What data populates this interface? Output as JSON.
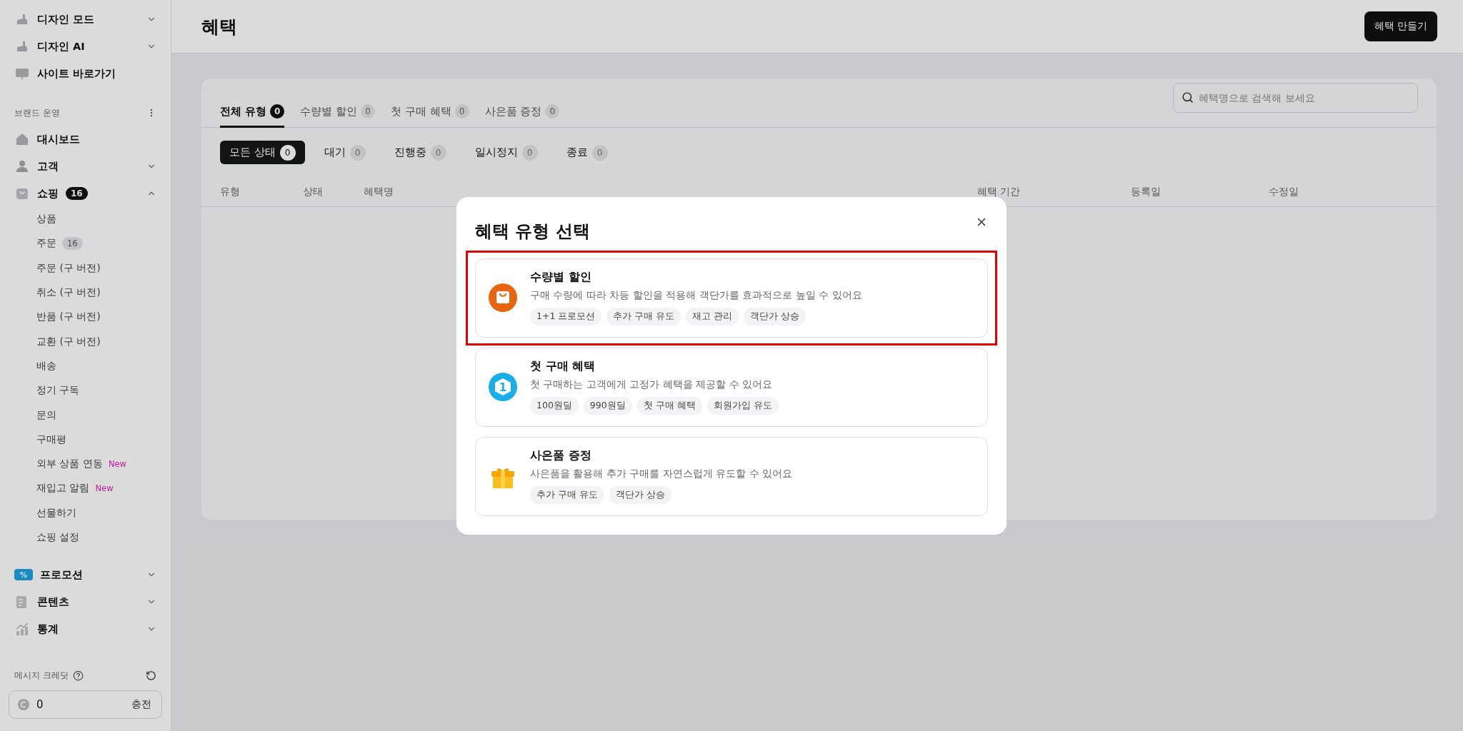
{
  "sidebar": {
    "top_items": [
      {
        "label": "디자인 모드",
        "expandable": true,
        "expanded": false
      },
      {
        "label": "디자인 AI",
        "expandable": true,
        "expanded": false
      },
      {
        "label": "사이트 바로가기",
        "expandable": false
      }
    ],
    "section": {
      "title": "브랜드 운영"
    },
    "items": [
      {
        "label": "대시보드",
        "expandable": false
      },
      {
        "label": "고객",
        "expandable": true,
        "expanded": false
      },
      {
        "label": "쇼핑",
        "badge": "16",
        "expandable": true,
        "expanded": true,
        "children": [
          {
            "label": "상품"
          },
          {
            "label": "주문",
            "badge": "16"
          },
          {
            "label": "주문 (구 버전)"
          },
          {
            "label": "취소 (구 버전)"
          },
          {
            "label": "반품 (구 버전)"
          },
          {
            "label": "교환 (구 버전)"
          },
          {
            "label": "배송"
          },
          {
            "label": "정기 구독"
          },
          {
            "label": "문의"
          },
          {
            "label": "구매평"
          },
          {
            "label": "외부 상품 연동",
            "new_tag": "New"
          },
          {
            "label": "재입고 알림",
            "new_tag": "New"
          },
          {
            "label": "선물하기"
          },
          {
            "label": "쇼핑 설정"
          }
        ]
      },
      {
        "label": "프로모션",
        "icon_label": "%",
        "expandable": true,
        "expanded": false
      },
      {
        "label": "콘텐츠",
        "expandable": true,
        "expanded": false
      },
      {
        "label": "통계",
        "expandable": true,
        "expanded": false
      }
    ],
    "credit": {
      "label": "메시지 크레딧",
      "value": "0",
      "action": "충전"
    }
  },
  "header": {
    "title": "혜택",
    "button": "혜택 만들기"
  },
  "type_tabs": [
    {
      "label": "전체 유형",
      "count": "0",
      "selected": true
    },
    {
      "label": "수량별 할인",
      "count": "0",
      "selected": false
    },
    {
      "label": "첫 구매 혜택",
      "count": "0",
      "selected": false
    },
    {
      "label": "사은품 증정",
      "count": "0",
      "selected": false
    }
  ],
  "search": {
    "placeholder": "혜택명으로 검색해 보세요"
  },
  "status_filters": [
    {
      "label": "모든 상태",
      "count": "0",
      "selected": true
    },
    {
      "label": "대기",
      "count": "0",
      "selected": false
    },
    {
      "label": "진행중",
      "count": "0",
      "selected": false
    },
    {
      "label": "일시정지",
      "count": "0",
      "selected": false
    },
    {
      "label": "종료",
      "count": "0",
      "selected": false
    }
  ],
  "table": {
    "columns": [
      "유형",
      "상태",
      "혜택명",
      "혜택 기간",
      "등록일",
      "수정일"
    ]
  },
  "modal": {
    "title": "혜택 유형 선택",
    "options": [
      {
        "title": "수량별 할인",
        "description": "구매 수량에 따라 차등 할인을 적용해 객단가를 효과적으로 높일 수 있어요",
        "tags": [
          "1+1 프로모션",
          "추가 구매 유도",
          "재고 관리",
          "객단가 상승"
        ],
        "highlighted": true
      },
      {
        "title": "첫 구매 혜택",
        "icon_label": "1",
        "description": "첫 구매하는 고객에게 고정가 혜택을 제공할 수 있어요",
        "tags": [
          "100원딜",
          "990원딜",
          "첫 구매 혜택",
          "회원가입 유도"
        ],
        "highlighted": false
      },
      {
        "title": "사은품 증정",
        "description": "사은품을 활용해 추가 구매를 자연스럽게 유도할 수 있어요",
        "tags": [
          "추가 구매 유도",
          "객단가 상승"
        ],
        "highlighted": false
      }
    ]
  }
}
